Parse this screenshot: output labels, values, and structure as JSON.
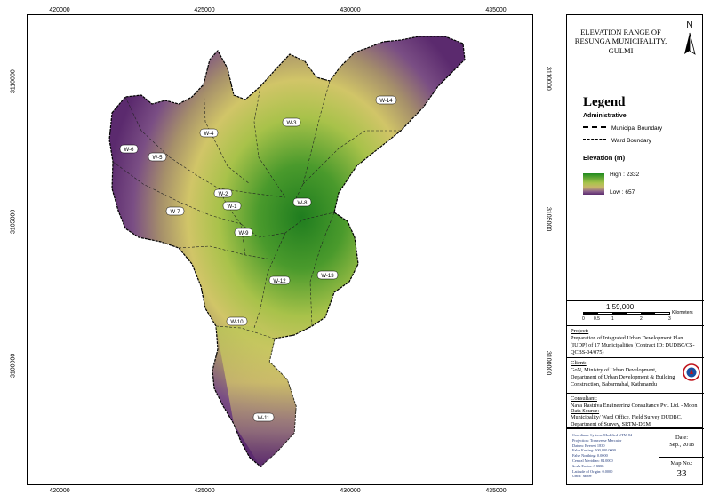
{
  "map": {
    "top_ticks": [
      "420000",
      "425000",
      "430000",
      "435000"
    ],
    "bottom_ticks": [
      "420000",
      "425000",
      "430000",
      "435000"
    ],
    "left_ticks": [
      "3110000",
      "3105000",
      "3100000"
    ],
    "right_ticks": [
      "3110000",
      "3105000",
      "3100000"
    ],
    "wards": [
      "W-1",
      "W-2",
      "W-3",
      "W-4",
      "W-5",
      "W-6",
      "W-7",
      "W-8",
      "W-9",
      "W-10",
      "W-11",
      "W-12",
      "W-13",
      "W-14"
    ]
  },
  "panel": {
    "title": "ELEVATION RANGE OF RESUNGA MUNICIPALITY, GULMI",
    "north": "N"
  },
  "legend": {
    "heading": "Legend",
    "administrative": "Administrative",
    "municipal_boundary": "Municipal Boundary",
    "ward_boundary": "Ward Boundary",
    "elevation_title": "Elevation (m)",
    "high": "High : 2332",
    "low": "Low : 657",
    "colors": {
      "high": "#1f8a1f",
      "mid": "#c8c05a",
      "low": "#5b2a6e"
    }
  },
  "scale": {
    "ratio": "1:59,000",
    "unit": "Kilometers",
    "ticks": [
      "0",
      "0.5",
      "1",
      "2",
      "3"
    ]
  },
  "project": {
    "heading": "Project:",
    "text": "Preparation of Integrated Urban Development Plan (IUDP) of 17 Municipalities (Contract ID: DUDBC/CS-QCBS-04/075)"
  },
  "client": {
    "heading": "Client:",
    "text": "GoN, Ministry of Urban Development, Department of Urban Development & Building Construction, Babarmahal, Kathmandu"
  },
  "consultant": {
    "heading": "Consultant:",
    "text": "Naya Rastriya Engineering Consultancy Pvt. Ltd. - Moon Light Civil Solution Pvt. Ltd. - Green Innovative Pvt. Ltd. (NREC-MCS-GI) JV"
  },
  "data_source": {
    "heading": "Data Source:",
    "text": "Municipality/ Ward Office, Field Survey DUDBC, Department of Survey, SRTM-DEM"
  },
  "coords": [
    "Coordinate System: Modified UTM 84",
    "Projection: Transverse Mercator",
    "Datum: Everest 1830",
    "False Easting: 500,000.0000",
    "False Northing: 0.0000",
    "Central Meridian: 84.0000",
    "Scale Factor: 0.9999",
    "Latitude of Origin: 0.0000",
    "Units: Meter"
  ],
  "date": {
    "label": "Date:",
    "value": "Sep., 2018"
  },
  "map_no": {
    "label": "Map No.:",
    "value": "33"
  }
}
